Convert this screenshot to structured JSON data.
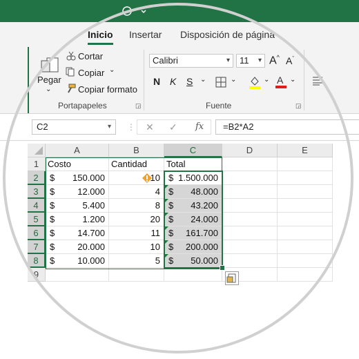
{
  "ribbon_tabs": [
    {
      "label": "Inicio",
      "active": true
    },
    {
      "label": "Insertar",
      "active": false
    },
    {
      "label": "Disposición de página",
      "active": false
    }
  ],
  "clipboard": {
    "paste_label": "Pegar",
    "cut_label": "Cortar",
    "copy_label": "Copiar",
    "format_painter_label": "Copiar formato",
    "group_label": "Portapapeles"
  },
  "font_group": {
    "font_name": "Calibri",
    "font_size": "11",
    "bold_label": "N",
    "italic_label": "K",
    "underline_label": "S",
    "group_label": "Fuente",
    "highlight_color": "#ffff00",
    "font_color": "#e01b1b"
  },
  "formula_bar": {
    "name_box": "C2",
    "fx_label": "fx",
    "formula": "=B2*A2"
  },
  "columns": [
    "A",
    "B",
    "C",
    "D",
    "E"
  ],
  "rows": [
    "1",
    "2",
    "3",
    "4",
    "5",
    "6",
    "7",
    "8",
    "9"
  ],
  "sheet": {
    "headers": {
      "a": "Costo",
      "b": "Cantidad",
      "c": "Total"
    },
    "currency": "$",
    "data": [
      {
        "a": "150.000",
        "b": "10",
        "c": "1.500.000"
      },
      {
        "a": "12.000",
        "b": "4",
        "c": "48.000"
      },
      {
        "a": "5.400",
        "b": "8",
        "c": "43.200"
      },
      {
        "a": "1.200",
        "b": "20",
        "c": "24.000"
      },
      {
        "a": "14.700",
        "b": "11",
        "c": "161.700"
      },
      {
        "a": "20.000",
        "b": "10",
        "c": "200.000"
      },
      {
        "a": "10.000",
        "b": "5",
        "c": "50.000"
      }
    ]
  },
  "colors": {
    "accent": "#217346",
    "error_marker": "#1e7b3e",
    "warning": "#f0a030"
  }
}
